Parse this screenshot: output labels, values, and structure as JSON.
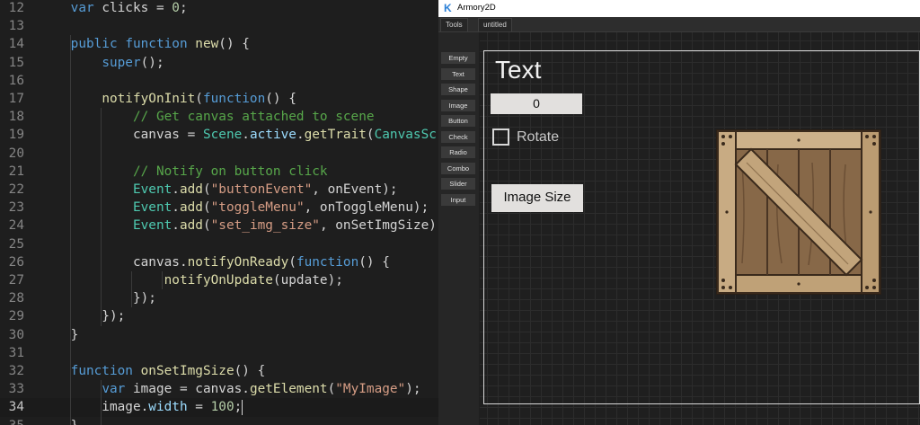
{
  "editor": {
    "current_line": "34",
    "lines": [
      {
        "num": "12",
        "indent": 0,
        "parts": [
          {
            "t": "    "
          },
          {
            "t": "var",
            "c": "k"
          },
          {
            "t": " clicks = "
          },
          {
            "t": "0",
            "c": "n"
          },
          {
            "t": ";"
          }
        ]
      },
      {
        "num": "13",
        "parts": []
      },
      {
        "num": "14",
        "parts": [
          {
            "t": "    "
          },
          {
            "t": "public",
            "c": "k"
          },
          {
            "t": " "
          },
          {
            "t": "function",
            "c": "k"
          },
          {
            "t": " "
          },
          {
            "t": "new",
            "c": "f"
          },
          {
            "t": "() {"
          }
        ]
      },
      {
        "num": "15",
        "parts": [
          {
            "t": "        "
          },
          {
            "t": "super",
            "c": "k"
          },
          {
            "t": "();"
          }
        ]
      },
      {
        "num": "16",
        "parts": []
      },
      {
        "num": "17",
        "parts": [
          {
            "t": "        "
          },
          {
            "t": "notifyOnInit",
            "c": "f"
          },
          {
            "t": "("
          },
          {
            "t": "function",
            "c": "k"
          },
          {
            "t": "() {"
          }
        ]
      },
      {
        "num": "18",
        "parts": [
          {
            "t": "            "
          },
          {
            "t": "// Get canvas attached to scene",
            "c": "c"
          }
        ]
      },
      {
        "num": "19",
        "parts": [
          {
            "t": "            canvas = "
          },
          {
            "t": "Scene",
            "c": "t"
          },
          {
            "t": "."
          },
          {
            "t": "active",
            "c": "v"
          },
          {
            "t": "."
          },
          {
            "t": "getTrait",
            "c": "f"
          },
          {
            "t": "("
          },
          {
            "t": "CanvasScrip",
            "c": "t"
          }
        ]
      },
      {
        "num": "20",
        "parts": []
      },
      {
        "num": "21",
        "parts": [
          {
            "t": "            "
          },
          {
            "t": "// Notify on button click",
            "c": "c"
          }
        ]
      },
      {
        "num": "22",
        "parts": [
          {
            "t": "            "
          },
          {
            "t": "Event",
            "c": "t"
          },
          {
            "t": "."
          },
          {
            "t": "add",
            "c": "f"
          },
          {
            "t": "("
          },
          {
            "t": "\"buttonEvent\"",
            "c": "s"
          },
          {
            "t": ", onEvent);"
          }
        ]
      },
      {
        "num": "23",
        "parts": [
          {
            "t": "            "
          },
          {
            "t": "Event",
            "c": "t"
          },
          {
            "t": "."
          },
          {
            "t": "add",
            "c": "f"
          },
          {
            "t": "("
          },
          {
            "t": "\"toggleMenu\"",
            "c": "s"
          },
          {
            "t": ", onToggleMenu);"
          }
        ]
      },
      {
        "num": "24",
        "parts": [
          {
            "t": "            "
          },
          {
            "t": "Event",
            "c": "t"
          },
          {
            "t": "."
          },
          {
            "t": "add",
            "c": "f"
          },
          {
            "t": "("
          },
          {
            "t": "\"set_img_size\"",
            "c": "s"
          },
          {
            "t": ", onSetImgSize);"
          }
        ]
      },
      {
        "num": "25",
        "parts": []
      },
      {
        "num": "26",
        "parts": [
          {
            "t": "            canvas."
          },
          {
            "t": "notifyOnReady",
            "c": "f"
          },
          {
            "t": "("
          },
          {
            "t": "function",
            "c": "k"
          },
          {
            "t": "() {"
          }
        ]
      },
      {
        "num": "27",
        "parts": [
          {
            "t": "                "
          },
          {
            "t": "notifyOnUpdate",
            "c": "f"
          },
          {
            "t": "(update);"
          }
        ]
      },
      {
        "num": "28",
        "parts": [
          {
            "t": "            });"
          }
        ]
      },
      {
        "num": "29",
        "parts": [
          {
            "t": "        });"
          }
        ]
      },
      {
        "num": "30",
        "parts": [
          {
            "t": "    }"
          }
        ]
      },
      {
        "num": "31",
        "parts": []
      },
      {
        "num": "32",
        "parts": [
          {
            "t": "    "
          },
          {
            "t": "function",
            "c": "k"
          },
          {
            "t": " "
          },
          {
            "t": "onSetImgSize",
            "c": "f"
          },
          {
            "t": "() {"
          }
        ]
      },
      {
        "num": "33",
        "parts": [
          {
            "t": "        "
          },
          {
            "t": "var",
            "c": "k"
          },
          {
            "t": " image = canvas."
          },
          {
            "t": "getElement",
            "c": "f"
          },
          {
            "t": "("
          },
          {
            "t": "\"MyImage\"",
            "c": "s"
          },
          {
            "t": ");"
          }
        ]
      },
      {
        "num": "34",
        "parts": [
          {
            "t": "        image."
          },
          {
            "t": "width",
            "c": "v"
          },
          {
            "t": " = "
          },
          {
            "t": "100",
            "c": "n"
          },
          {
            "t": ";"
          }
        ]
      },
      {
        "num": "35",
        "parts": [
          {
            "t": "    }"
          }
        ]
      }
    ]
  },
  "app": {
    "title": "Armory2D",
    "logo_letter": "K",
    "tabs": [
      "Tools",
      "untitled"
    ],
    "tools": [
      "Empty",
      "Text",
      "Shape",
      "Image",
      "Button",
      "Check",
      "Radio",
      "Combo",
      "Slider",
      "Input"
    ],
    "canvas": {
      "text_element": "Text",
      "button_value": "0",
      "checkbox_label": "Rotate",
      "image_size_button": "Image Size"
    }
  },
  "colors": {
    "editor_bg": "#1e1e1e",
    "keyword": "#569cd6",
    "function": "#dcdcaa",
    "comment": "#57a64a",
    "string": "#d69d85",
    "type": "#4ec9b0",
    "canvas_bg": "#1f1f1f",
    "crate_wood": "#b0926a"
  }
}
